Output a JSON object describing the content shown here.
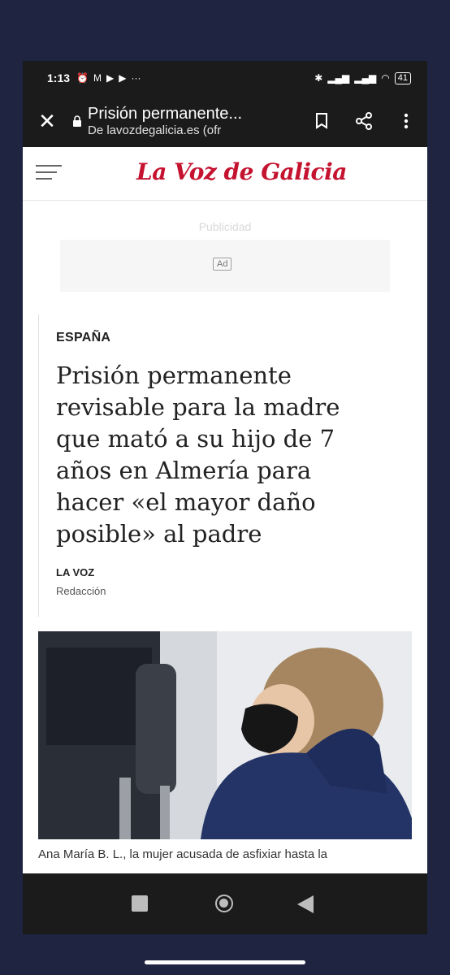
{
  "status_bar": {
    "time": "1:13",
    "battery": "41"
  },
  "toolbar": {
    "title": "Prisión permanente...",
    "url": "De lavozdegalicia.es (ofr"
  },
  "site": {
    "logo": "La Voz de Galicia"
  },
  "ad": {
    "label": "Publicidad",
    "badge": "Ad"
  },
  "article": {
    "section": "ESPAÑA",
    "headline": "Prisión permanente revisable para la madre que mató a su hijo de 7 años en Almería para hacer «el mayor daño posible» al padre",
    "author": "LA VOZ",
    "role": "Redacción",
    "caption": "Ana María B. L., la mujer acusada de asfixiar hasta la"
  },
  "colors": {
    "brand_red": "#c4122f",
    "chrome_bar": "#1b1b1b"
  }
}
